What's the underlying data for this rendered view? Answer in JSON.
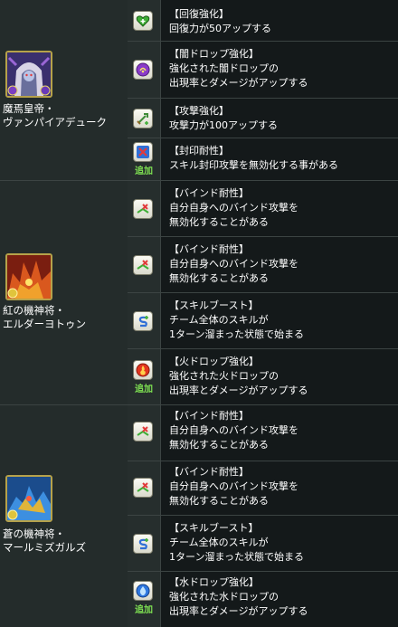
{
  "characters": [
    {
      "name_line1": "魔焉皇帝・",
      "name_line2": "ヴァンパイアデューク",
      "portrait_icon": "vampire-duke-portrait",
      "skills": [
        {
          "title": "【回復強化】",
          "lines": [
            "回復力が50アップする"
          ],
          "icon": "heart-heal-icon"
        },
        {
          "title": "【闇ドロップ強化】",
          "lines": [
            "強化された闇ドロップの",
            "出現率とダメージがアップする"
          ],
          "icon": "dark-orb-icon"
        },
        {
          "title": "【攻撃強化】",
          "lines": [
            "攻撃力が100アップする"
          ],
          "icon": "sword-attack-icon"
        },
        {
          "title": "【封印耐性】",
          "lines": [
            "スキル封印攻撃を無効化する事がある"
          ],
          "icon": "skill-seal-resist-icon",
          "tag": "追加"
        }
      ]
    },
    {
      "name_line1": "紅の機神将・",
      "name_line2": "エルダーヨトゥン",
      "portrait_icon": "elder-jotun-portrait",
      "skills": [
        {
          "title": "【バインド耐性】",
          "lines": [
            "自分自身へのバインド攻撃を",
            "無効化することがある"
          ],
          "icon": "bind-resist-icon"
        },
        {
          "title": "【バインド耐性】",
          "lines": [
            "自分自身へのバインド攻撃を",
            "無効化することがある"
          ],
          "icon": "bind-resist-icon"
        },
        {
          "title": "【スキルブースト】",
          "lines": [
            "チーム全体のスキルが",
            "1ターン溜まった状態で始まる"
          ],
          "icon": "skill-boost-icon"
        },
        {
          "title": "【火ドロップ強化】",
          "lines": [
            "強化された火ドロップの",
            "出現率とダメージがアップする"
          ],
          "icon": "fire-orb-icon",
          "tag": "追加"
        }
      ]
    },
    {
      "name_line1": "蒼の機神将・",
      "name_line2": "マールミズガルズ",
      "portrait_icon": "mar-midgardsormr-portrait",
      "skills": [
        {
          "title": "【バインド耐性】",
          "lines": [
            "自分自身へのバインド攻撃を",
            "無効化することがある"
          ],
          "icon": "bind-resist-icon"
        },
        {
          "title": "【バインド耐性】",
          "lines": [
            "自分自身へのバインド攻撃を",
            "無効化することがある"
          ],
          "icon": "bind-resist-icon"
        },
        {
          "title": "【スキルブースト】",
          "lines": [
            "チーム全体のスキルが",
            "1ターン溜まった状態で始まる"
          ],
          "icon": "skill-boost-icon"
        },
        {
          "title": "【水ドロップ強化】",
          "lines": [
            "強化された水ドロップの",
            "出現率とダメージがアップする"
          ],
          "icon": "water-orb-icon",
          "tag": "追加"
        }
      ]
    }
  ],
  "colors": {
    "background": "#14191a",
    "cell": "#242c2b",
    "border": "#3c4443",
    "text": "#ffffff",
    "tag": "#7ee052",
    "portrait_frame": "#b6a24a"
  }
}
